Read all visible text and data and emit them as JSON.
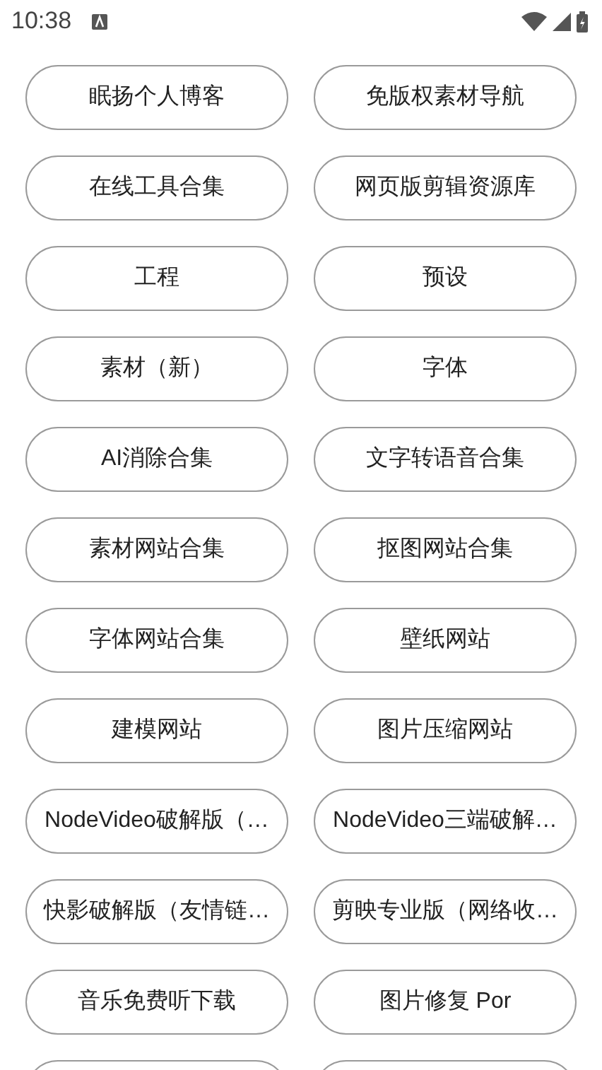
{
  "status_bar": {
    "time": "10:38"
  },
  "links": [
    {
      "kind": "text",
      "label": "眠扬个人博客"
    },
    {
      "kind": "text",
      "label": "免版权素材导航"
    },
    {
      "kind": "text",
      "label": "在线工具合集"
    },
    {
      "kind": "text",
      "label": "网页版剪辑资源库"
    },
    {
      "kind": "text",
      "label": "工程"
    },
    {
      "kind": "text",
      "label": "预设"
    },
    {
      "kind": "text",
      "label": "素材（新）"
    },
    {
      "kind": "text",
      "label": "字体"
    },
    {
      "kind": "text",
      "label": "AI消除合集"
    },
    {
      "kind": "text",
      "label": "文字转语音合集"
    },
    {
      "kind": "text",
      "label": "素材网站合集"
    },
    {
      "kind": "text",
      "label": "抠图网站合集"
    },
    {
      "kind": "text",
      "label": "字体网站合集"
    },
    {
      "kind": "text",
      "label": "壁纸网站"
    },
    {
      "kind": "text",
      "label": "建模网站"
    },
    {
      "kind": "text",
      "label": "图片压缩网站"
    },
    {
      "kind": "text",
      "label": "NodeVideo破解版（…"
    },
    {
      "kind": "text",
      "label": "NodeVideo三端破解…"
    },
    {
      "kind": "text",
      "label": "快影破解版（友情链…"
    },
    {
      "kind": "text",
      "label": "剪映专业版（网络收…"
    },
    {
      "kind": "text",
      "label": "音乐免费听下载"
    },
    {
      "kind": "text",
      "label": "图片修复 Por"
    },
    {
      "kind": "blank"
    },
    {
      "kind": "blank"
    }
  ]
}
